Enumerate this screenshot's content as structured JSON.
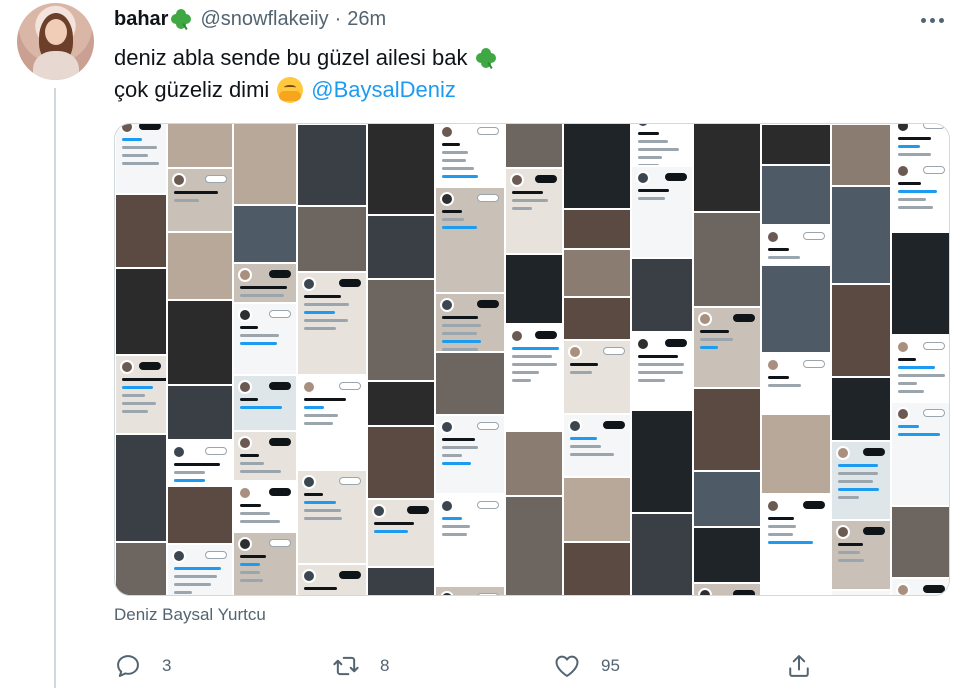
{
  "tweet": {
    "display_name": "bahar",
    "handle": "@snowflakeiiy",
    "separator": "·",
    "time": "26m",
    "text_line1": "deniz abla sende bu güzel ailesi bak",
    "text_line2": "çok güzeliz dimi",
    "mention": "@BaysalDeniz",
    "media_caption": "Deniz Baysal Yurtcu"
  },
  "actions": {
    "reply_count": "3",
    "retweet_count": "8",
    "like_count": "95"
  },
  "icons": {
    "more": "more-icon",
    "reply": "reply-icon",
    "retweet": "retweet-icon",
    "like": "like-icon",
    "share": "share-icon",
    "clover": "four-leaf-clover-icon",
    "hug": "hugging-face-icon"
  },
  "colors": {
    "link": "#1d9bf0",
    "secondary_text": "#536471",
    "primary_text": "#0f1419",
    "clover": "#3fa844"
  }
}
